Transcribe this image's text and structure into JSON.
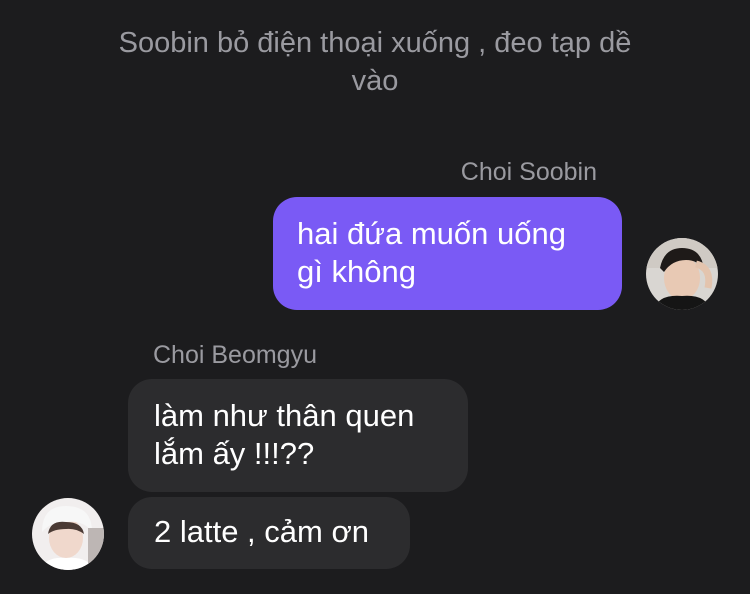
{
  "narration": "Soobin bỏ điện thoại xuống , đeo tạp dề vào",
  "messages": [
    {
      "sender": "Choi Soobin",
      "text": "hai đứa muốn uống gì không"
    },
    {
      "sender": "Choi Beomgyu",
      "text": "làm như thân quen lắm ấy !!!??"
    },
    {
      "sender": "Choi Beomgyu",
      "text": "2 latte , cảm ơn"
    }
  ],
  "colors": {
    "background": "#1c1c1e",
    "outgoing_bubble": "#7a5af5",
    "incoming_bubble": "#2c2c2e",
    "meta_text": "#9a9aa0"
  },
  "icons": {
    "soobin_avatar": "avatar-photo",
    "beomgyu_avatar": "avatar-photo"
  }
}
